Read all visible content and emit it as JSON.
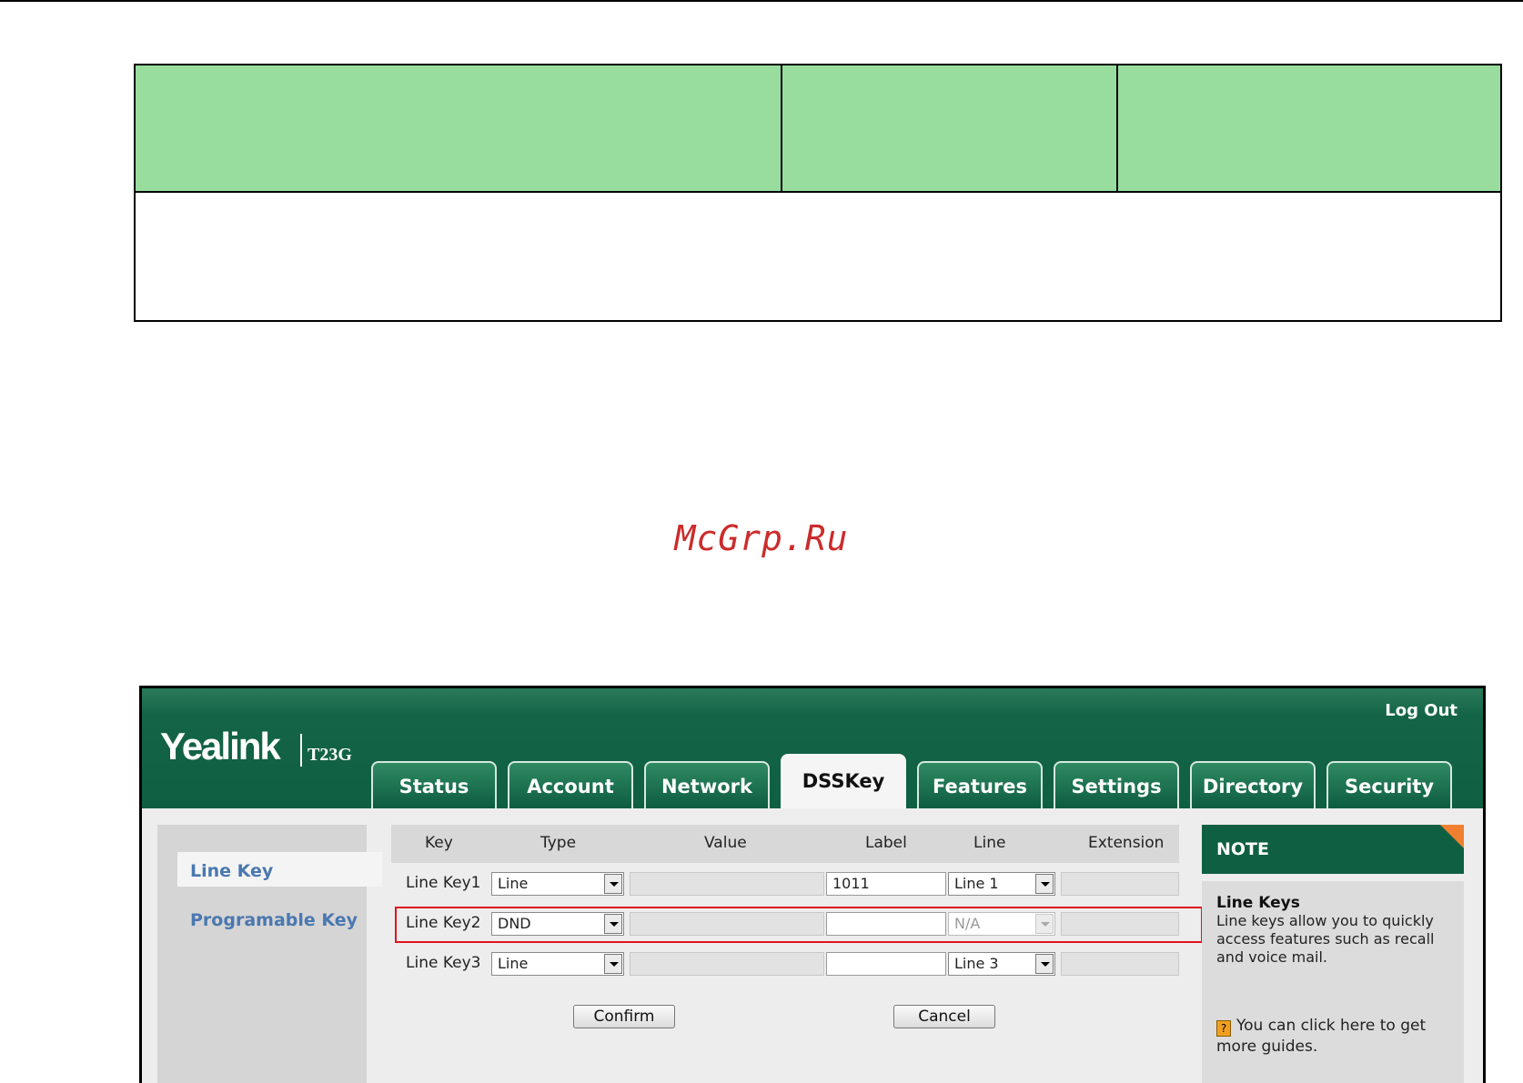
{
  "watermark": "McGrp.Ru",
  "app": {
    "logo": "Yealink",
    "model": "T23G",
    "logout": "Log Out",
    "tabs": [
      {
        "label": "Status",
        "active": false
      },
      {
        "label": "Account",
        "active": false
      },
      {
        "label": "Network",
        "active": false
      },
      {
        "label": "DSSKey",
        "active": true
      },
      {
        "label": "Features",
        "active": false
      },
      {
        "label": "Settings",
        "active": false
      },
      {
        "label": "Directory",
        "active": false
      },
      {
        "label": "Security",
        "active": false
      }
    ]
  },
  "sidebar": {
    "items": [
      {
        "label": "Line Key",
        "selected": true
      },
      {
        "label": "Programable Key",
        "selected": false
      }
    ]
  },
  "table": {
    "columns": [
      "Key",
      "Type",
      "Value",
      "Label",
      "Line",
      "Extension"
    ],
    "rows": [
      {
        "key": "Line Key1",
        "type": "Line",
        "value": "",
        "label": "1011",
        "line": "Line 1",
        "extension": ""
      },
      {
        "key": "Line Key2",
        "type": "DND",
        "value": "",
        "label": "",
        "line": "N/A",
        "extension": "",
        "highlighted": true
      },
      {
        "key": "Line Key3",
        "type": "Line",
        "value": "",
        "label": "",
        "line": "Line 3",
        "extension": ""
      }
    ]
  },
  "buttons": {
    "confirm": "Confirm",
    "cancel": "Cancel"
  },
  "note": {
    "header": "NOTE",
    "title": "Line Keys",
    "text": "Line keys allow you to quickly access features such as recall and voice mail.",
    "guide": "You can click here to get more guides."
  },
  "colors": {
    "brand_green": "#0f5f43",
    "table_header_green": "#98dd9e",
    "highlight_red": "#e0141e",
    "note_corner": "#f08030"
  }
}
